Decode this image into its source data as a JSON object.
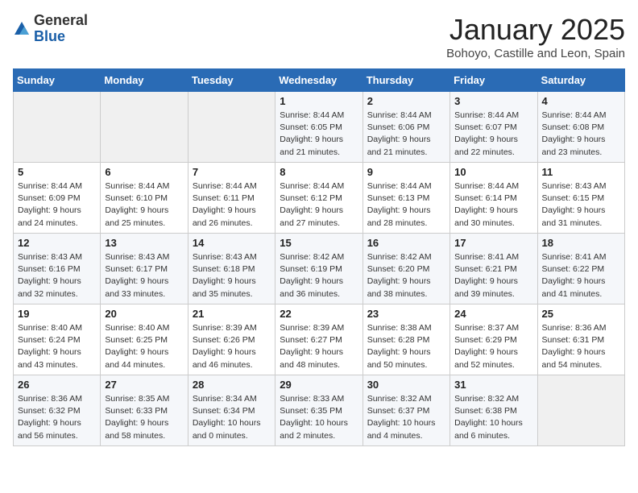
{
  "logo": {
    "general": "General",
    "blue": "Blue"
  },
  "title": "January 2025",
  "location": "Bohoyo, Castille and Leon, Spain",
  "weekdays": [
    "Sunday",
    "Monday",
    "Tuesday",
    "Wednesday",
    "Thursday",
    "Friday",
    "Saturday"
  ],
  "weeks": [
    [
      {
        "day": "",
        "sunrise": "",
        "sunset": "",
        "daylight": ""
      },
      {
        "day": "",
        "sunrise": "",
        "sunset": "",
        "daylight": ""
      },
      {
        "day": "",
        "sunrise": "",
        "sunset": "",
        "daylight": ""
      },
      {
        "day": "1",
        "sunrise": "Sunrise: 8:44 AM",
        "sunset": "Sunset: 6:05 PM",
        "daylight": "Daylight: 9 hours and 21 minutes."
      },
      {
        "day": "2",
        "sunrise": "Sunrise: 8:44 AM",
        "sunset": "Sunset: 6:06 PM",
        "daylight": "Daylight: 9 hours and 21 minutes."
      },
      {
        "day": "3",
        "sunrise": "Sunrise: 8:44 AM",
        "sunset": "Sunset: 6:07 PM",
        "daylight": "Daylight: 9 hours and 22 minutes."
      },
      {
        "day": "4",
        "sunrise": "Sunrise: 8:44 AM",
        "sunset": "Sunset: 6:08 PM",
        "daylight": "Daylight: 9 hours and 23 minutes."
      }
    ],
    [
      {
        "day": "5",
        "sunrise": "Sunrise: 8:44 AM",
        "sunset": "Sunset: 6:09 PM",
        "daylight": "Daylight: 9 hours and 24 minutes."
      },
      {
        "day": "6",
        "sunrise": "Sunrise: 8:44 AM",
        "sunset": "Sunset: 6:10 PM",
        "daylight": "Daylight: 9 hours and 25 minutes."
      },
      {
        "day": "7",
        "sunrise": "Sunrise: 8:44 AM",
        "sunset": "Sunset: 6:11 PM",
        "daylight": "Daylight: 9 hours and 26 minutes."
      },
      {
        "day": "8",
        "sunrise": "Sunrise: 8:44 AM",
        "sunset": "Sunset: 6:12 PM",
        "daylight": "Daylight: 9 hours and 27 minutes."
      },
      {
        "day": "9",
        "sunrise": "Sunrise: 8:44 AM",
        "sunset": "Sunset: 6:13 PM",
        "daylight": "Daylight: 9 hours and 28 minutes."
      },
      {
        "day": "10",
        "sunrise": "Sunrise: 8:44 AM",
        "sunset": "Sunset: 6:14 PM",
        "daylight": "Daylight: 9 hours and 30 minutes."
      },
      {
        "day": "11",
        "sunrise": "Sunrise: 8:43 AM",
        "sunset": "Sunset: 6:15 PM",
        "daylight": "Daylight: 9 hours and 31 minutes."
      }
    ],
    [
      {
        "day": "12",
        "sunrise": "Sunrise: 8:43 AM",
        "sunset": "Sunset: 6:16 PM",
        "daylight": "Daylight: 9 hours and 32 minutes."
      },
      {
        "day": "13",
        "sunrise": "Sunrise: 8:43 AM",
        "sunset": "Sunset: 6:17 PM",
        "daylight": "Daylight: 9 hours and 33 minutes."
      },
      {
        "day": "14",
        "sunrise": "Sunrise: 8:43 AM",
        "sunset": "Sunset: 6:18 PM",
        "daylight": "Daylight: 9 hours and 35 minutes."
      },
      {
        "day": "15",
        "sunrise": "Sunrise: 8:42 AM",
        "sunset": "Sunset: 6:19 PM",
        "daylight": "Daylight: 9 hours and 36 minutes."
      },
      {
        "day": "16",
        "sunrise": "Sunrise: 8:42 AM",
        "sunset": "Sunset: 6:20 PM",
        "daylight": "Daylight: 9 hours and 38 minutes."
      },
      {
        "day": "17",
        "sunrise": "Sunrise: 8:41 AM",
        "sunset": "Sunset: 6:21 PM",
        "daylight": "Daylight: 9 hours and 39 minutes."
      },
      {
        "day": "18",
        "sunrise": "Sunrise: 8:41 AM",
        "sunset": "Sunset: 6:22 PM",
        "daylight": "Daylight: 9 hours and 41 minutes."
      }
    ],
    [
      {
        "day": "19",
        "sunrise": "Sunrise: 8:40 AM",
        "sunset": "Sunset: 6:24 PM",
        "daylight": "Daylight: 9 hours and 43 minutes."
      },
      {
        "day": "20",
        "sunrise": "Sunrise: 8:40 AM",
        "sunset": "Sunset: 6:25 PM",
        "daylight": "Daylight: 9 hours and 44 minutes."
      },
      {
        "day": "21",
        "sunrise": "Sunrise: 8:39 AM",
        "sunset": "Sunset: 6:26 PM",
        "daylight": "Daylight: 9 hours and 46 minutes."
      },
      {
        "day": "22",
        "sunrise": "Sunrise: 8:39 AM",
        "sunset": "Sunset: 6:27 PM",
        "daylight": "Daylight: 9 hours and 48 minutes."
      },
      {
        "day": "23",
        "sunrise": "Sunrise: 8:38 AM",
        "sunset": "Sunset: 6:28 PM",
        "daylight": "Daylight: 9 hours and 50 minutes."
      },
      {
        "day": "24",
        "sunrise": "Sunrise: 8:37 AM",
        "sunset": "Sunset: 6:29 PM",
        "daylight": "Daylight: 9 hours and 52 minutes."
      },
      {
        "day": "25",
        "sunrise": "Sunrise: 8:36 AM",
        "sunset": "Sunset: 6:31 PM",
        "daylight": "Daylight: 9 hours and 54 minutes."
      }
    ],
    [
      {
        "day": "26",
        "sunrise": "Sunrise: 8:36 AM",
        "sunset": "Sunset: 6:32 PM",
        "daylight": "Daylight: 9 hours and 56 minutes."
      },
      {
        "day": "27",
        "sunrise": "Sunrise: 8:35 AM",
        "sunset": "Sunset: 6:33 PM",
        "daylight": "Daylight: 9 hours and 58 minutes."
      },
      {
        "day": "28",
        "sunrise": "Sunrise: 8:34 AM",
        "sunset": "Sunset: 6:34 PM",
        "daylight": "Daylight: 10 hours and 0 minutes."
      },
      {
        "day": "29",
        "sunrise": "Sunrise: 8:33 AM",
        "sunset": "Sunset: 6:35 PM",
        "daylight": "Daylight: 10 hours and 2 minutes."
      },
      {
        "day": "30",
        "sunrise": "Sunrise: 8:32 AM",
        "sunset": "Sunset: 6:37 PM",
        "daylight": "Daylight: 10 hours and 4 minutes."
      },
      {
        "day": "31",
        "sunrise": "Sunrise: 8:32 AM",
        "sunset": "Sunset: 6:38 PM",
        "daylight": "Daylight: 10 hours and 6 minutes."
      },
      {
        "day": "",
        "sunrise": "",
        "sunset": "",
        "daylight": ""
      }
    ]
  ]
}
